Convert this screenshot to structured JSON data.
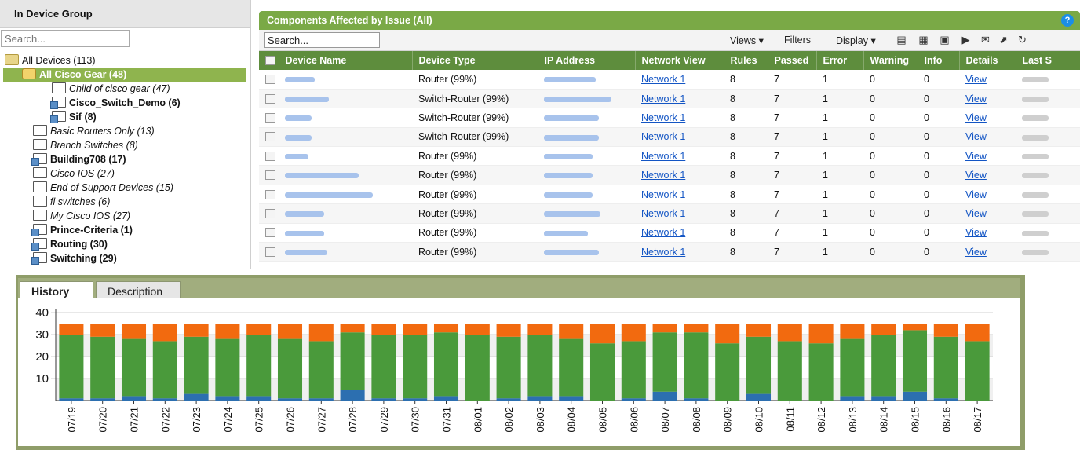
{
  "left_panel": {
    "title": "In Device Group",
    "search_placeholder": "Search...",
    "tree": [
      {
        "label": "All Devices (113)",
        "style": "normal",
        "icon": "gear-folder-icon",
        "indent": 0
      },
      {
        "label": "All Cisco Gear (48)",
        "style": "selected",
        "icon": "gear-icon",
        "indent": 1
      },
      {
        "label": "Child of cisco gear (47)",
        "style": "italic",
        "icon": "group-icon",
        "indent": 2
      },
      {
        "label": "Cisco_Switch_Demo (6)",
        "style": "bold",
        "icon": "dynamic-group-icon",
        "indent": 2
      },
      {
        "label": "Sif (8)",
        "style": "bold",
        "icon": "dynamic-group-icon",
        "indent": 2
      },
      {
        "label": "Basic Routers Only (13)",
        "style": "italic",
        "icon": "group-icon",
        "indent": 1
      },
      {
        "label": "Branch Switches (8)",
        "style": "italic",
        "icon": "group-icon",
        "indent": 1
      },
      {
        "label": "Building708 (17)",
        "style": "bold",
        "icon": "dynamic-group-icon",
        "indent": 1
      },
      {
        "label": "Cisco IOS (27)",
        "style": "italic",
        "icon": "group-icon",
        "indent": 1
      },
      {
        "label": "End of Support Devices (15)",
        "style": "italic",
        "icon": "group-icon",
        "indent": 1
      },
      {
        "label": "fl switches (6)",
        "style": "italic",
        "icon": "group-icon",
        "indent": 1
      },
      {
        "label": "My Cisco IOS (27)",
        "style": "italic",
        "icon": "group-icon",
        "indent": 1
      },
      {
        "label": "Prince-Criteria (1)",
        "style": "bold",
        "icon": "dynamic-group-icon",
        "indent": 1
      },
      {
        "label": "Routing (30)",
        "style": "bold",
        "icon": "dynamic-group-icon",
        "indent": 1
      },
      {
        "label": "Switching (29)",
        "style": "bold",
        "icon": "dynamic-group-icon",
        "indent": 1
      }
    ]
  },
  "components_panel": {
    "title": "Components Affected by Issue (All)",
    "search_value": "Search...",
    "toolbar": {
      "views": "Views ▾",
      "filters": "Filters",
      "display": "Display ▾"
    },
    "columns": [
      "",
      "Device Name",
      "Device Type",
      "IP Address",
      "Network View",
      "Rules",
      "Passed",
      "Error",
      "Warning",
      "Info",
      "Details",
      "Last S"
    ],
    "rows": [
      {
        "type": "Router (99%)",
        "network": "Network 1",
        "rules": "8",
        "passed": "7",
        "error": "1",
        "warning": "0",
        "info": "0",
        "details": "View"
      },
      {
        "type": "Switch-Router (99%)",
        "network": "Network 1",
        "rules": "8",
        "passed": "7",
        "error": "1",
        "warning": "0",
        "info": "0",
        "details": "View"
      },
      {
        "type": "Switch-Router (99%)",
        "network": "Network 1",
        "rules": "8",
        "passed": "7",
        "error": "1",
        "warning": "0",
        "info": "0",
        "details": "View"
      },
      {
        "type": "Switch-Router (99%)",
        "network": "Network 1",
        "rules": "8",
        "passed": "7",
        "error": "1",
        "warning": "0",
        "info": "0",
        "details": "View"
      },
      {
        "type": "Router (99%)",
        "network": "Network 1",
        "rules": "8",
        "passed": "7",
        "error": "1",
        "warning": "0",
        "info": "0",
        "details": "View"
      },
      {
        "type": "Router (99%)",
        "network": "Network 1",
        "rules": "8",
        "passed": "7",
        "error": "1",
        "warning": "0",
        "info": "0",
        "details": "View"
      },
      {
        "type": "Router (99%)",
        "network": "Network 1",
        "rules": "8",
        "passed": "7",
        "error": "1",
        "warning": "0",
        "info": "0",
        "details": "View"
      },
      {
        "type": "Router (99%)",
        "network": "Network 1",
        "rules": "8",
        "passed": "7",
        "error": "1",
        "warning": "0",
        "info": "0",
        "details": "View"
      },
      {
        "type": "Router (99%)",
        "network": "Network 1",
        "rules": "8",
        "passed": "7",
        "error": "1",
        "warning": "0",
        "info": "0",
        "details": "View"
      },
      {
        "type": "Router (99%)",
        "network": "Network 1",
        "rules": "8",
        "passed": "7",
        "error": "1",
        "warning": "0",
        "info": "0",
        "details": "View"
      }
    ]
  },
  "history_panel": {
    "tabs": [
      "History",
      "Description"
    ],
    "active_tab": "History"
  },
  "colors": {
    "header_green": "#7aa946",
    "grid_header": "#5e8d3d",
    "bar_green": "#4a9a3b",
    "bar_orange": "#f26a0f",
    "bar_blue": "#2c6fb0",
    "link": "#1355c4"
  },
  "chart_data": {
    "type": "bar",
    "stacked": true,
    "categories": [
      "07/19",
      "07/20",
      "07/21",
      "07/22",
      "07/23",
      "07/24",
      "07/25",
      "07/26",
      "07/27",
      "07/28",
      "07/29",
      "07/30",
      "07/31",
      "08/01",
      "08/02",
      "08/03",
      "08/04",
      "08/05",
      "08/06",
      "08/07",
      "08/08",
      "08/09",
      "08/10",
      "08/11",
      "08/12",
      "08/13",
      "08/14",
      "08/15",
      "08/16",
      "08/17"
    ],
    "series": [
      {
        "color": "#2c6fb0",
        "values": [
          1,
          1,
          2,
          1,
          3,
          2,
          2,
          1,
          1,
          5,
          1,
          1,
          2,
          0,
          1,
          2,
          2,
          0,
          1,
          4,
          1,
          0,
          3,
          0,
          0,
          2,
          2,
          4,
          1,
          0
        ]
      },
      {
        "color": "#4a9a3b",
        "values": [
          29,
          28,
          26,
          26,
          26,
          26,
          28,
          27,
          26,
          26,
          29,
          29,
          29,
          30,
          28,
          28,
          26,
          26,
          26,
          27,
          30,
          26,
          26,
          27,
          26,
          26,
          28,
          28,
          28,
          27
        ]
      },
      {
        "color": "#f26a0f",
        "values": [
          5,
          6,
          7,
          8,
          6,
          7,
          5,
          7,
          8,
          4,
          5,
          5,
          4,
          5,
          6,
          5,
          7,
          9,
          8,
          4,
          4,
          9,
          6,
          8,
          9,
          7,
          5,
          3,
          6,
          8
        ]
      }
    ],
    "ylim": [
      0,
      40
    ],
    "yticks": [
      10,
      20,
      30,
      40
    ],
    "grid": true,
    "legend": "none"
  }
}
